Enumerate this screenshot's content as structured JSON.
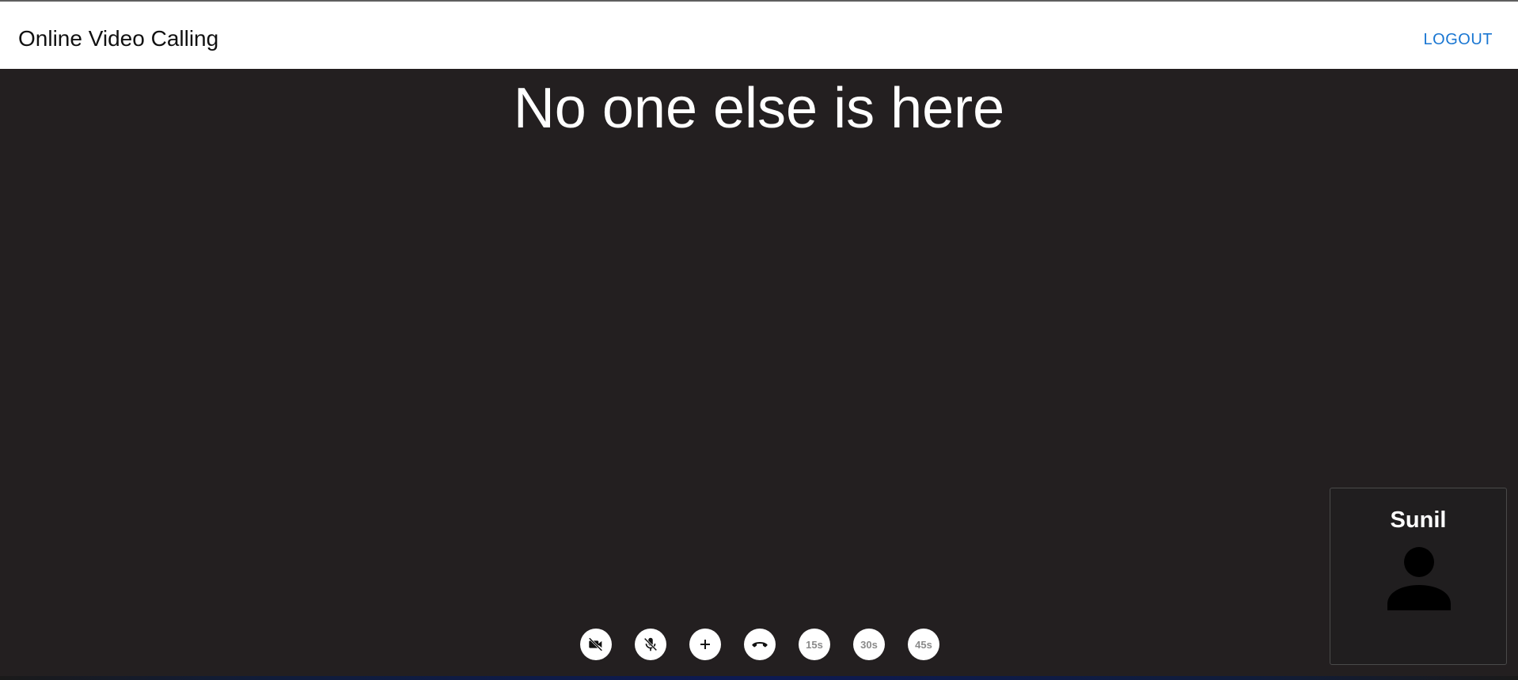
{
  "header": {
    "title": "Online Video Calling",
    "logout_label": "LOGOUT"
  },
  "stage": {
    "empty_message": "No one else is here"
  },
  "controls": [
    {
      "name": "camera-off-button",
      "icon": "videocam-off-icon",
      "label": ""
    },
    {
      "name": "mic-off-button",
      "icon": "mic-off-icon",
      "label": ""
    },
    {
      "name": "add-button",
      "icon": "plus-icon",
      "label": ""
    },
    {
      "name": "hang-up-button",
      "icon": "call-end-icon",
      "label": ""
    },
    {
      "name": "timer-15s-button",
      "icon": "",
      "label": "15s"
    },
    {
      "name": "timer-30s-button",
      "icon": "",
      "label": "30s"
    },
    {
      "name": "timer-45s-button",
      "icon": "",
      "label": "45s"
    }
  ],
  "self_view": {
    "name": "Sunil",
    "avatar_icon": "person-icon"
  },
  "colors": {
    "appbar_bg": "#ffffff",
    "stage_bg": "#231f20",
    "accent": "#1976d2",
    "control_bg": "#ffffff"
  }
}
